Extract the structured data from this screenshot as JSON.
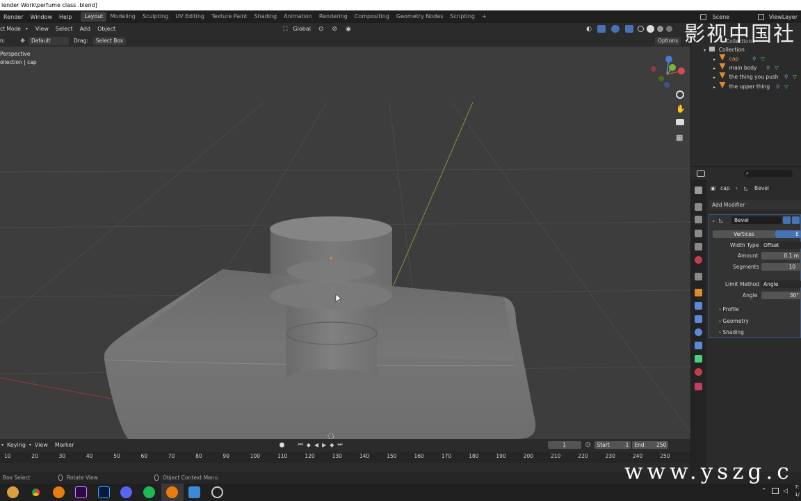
{
  "window_title": "lender Work\\perfume class .blend]",
  "menu": {
    "items": [
      "Render",
      "Window",
      "Help"
    ],
    "workspaces": [
      "Layout",
      "Modeling",
      "Sculpting",
      "UV Editing",
      "Texture Paint",
      "Shading",
      "Animation",
      "Rendering",
      "Compositing",
      "Geometry Nodes",
      "Scripting",
      "+"
    ],
    "active_workspace": "Layout",
    "scene_label": "Scene",
    "viewlayer_label": "ViewLayer"
  },
  "viewport_header": {
    "mode": "ct Mode",
    "menus": [
      "View",
      "Select",
      "Add",
      "Object"
    ],
    "transform_orientation": "Global"
  },
  "tool_settings": {
    "orientation_label": "n:",
    "orientation_value": "Default",
    "drag_label": "Drag:",
    "drag_value": "Select Box",
    "options_label": "Options"
  },
  "viewport": {
    "view_name": "Perspective",
    "collection_info": "ollection | cap"
  },
  "outliner": {
    "collection_label": "Collection",
    "root": "Collection",
    "items": [
      {
        "name": "cap"
      },
      {
        "name": "main body"
      },
      {
        "name": "the thing you push"
      },
      {
        "name": "the upper thing"
      }
    ]
  },
  "properties": {
    "breadcrumb_object": "cap",
    "breadcrumb_modifier": "Bevel",
    "add_modifier": "Add Modifier",
    "modifier_name": "Bevel",
    "affect_vertices": "Vertices",
    "affect_edges": "E",
    "width_type_label": "Width Type",
    "width_type_value": "Offset",
    "amount_label": "Amount",
    "amount_value": "0.1 m",
    "segments_label": "Segments",
    "segments_value": "10",
    "limit_method_label": "Limit Method",
    "limit_method_value": "Angle",
    "angle_label": "Angle",
    "angle_value": "30°",
    "subpanels": [
      "Profile",
      "Geometry",
      "Shading"
    ]
  },
  "timeline": {
    "keying_label": "Keying",
    "view_label": "View",
    "marker_label": "Marker",
    "current_frame": "1",
    "start_label": "Start",
    "start_value": "1",
    "end_label": "End",
    "end_value": "250",
    "ruler_ticks": [
      "10",
      "20",
      "30",
      "40",
      "50",
      "60",
      "70",
      "80",
      "90",
      "100",
      "110",
      "120",
      "130",
      "140",
      "150",
      "160",
      "170",
      "180",
      "190",
      "200",
      "210",
      "220",
      "230",
      "240",
      "250"
    ]
  },
  "statusbar": {
    "left": "Box Select",
    "middle": "Rotate View",
    "right": "Object Context Menu"
  },
  "taskbar": {
    "icons": [
      "chrome-icon",
      "blender-icon",
      "premiere-icon",
      "photoshop-icon",
      "discord-icon",
      "spotify-icon",
      "blender-active-icon",
      "photos-icon",
      "app-icon"
    ],
    "clock_line1": "7:",
    "clock_line2": "1/"
  },
  "watermark": {
    "top": "影视中国社",
    "bottom": "www.yszg.c"
  }
}
